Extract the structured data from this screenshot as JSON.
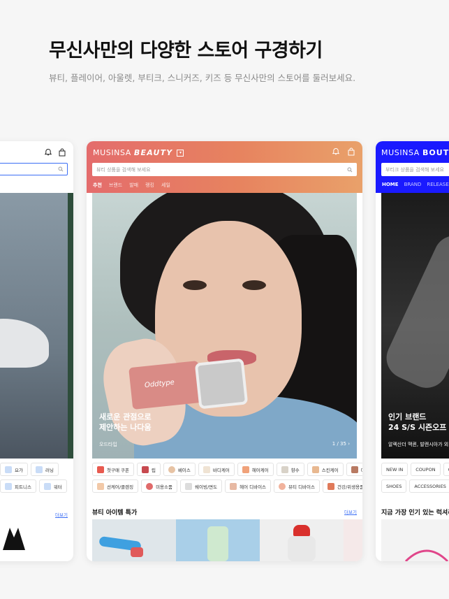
{
  "headline": "무신사만의 다양한 스토어 구경하기",
  "subline": "뷰티, 플레이어, 아울렛, 부티크, 스니커즈, 키즈 등 무신사만의 스토어를 둘러보세요.",
  "left_card": {
    "chips_row1": [
      "요가",
      "러닝"
    ],
    "chips_row2": [
      "피트니스",
      "워터"
    ],
    "more": "더보기"
  },
  "beauty_card": {
    "brand_a": "MUSINSA",
    "brand_b": "BEAUTY",
    "search_placeholder": "뷰티 상품을 검색해 보세요",
    "tabs": [
      "추천",
      "브랜드",
      "발매",
      "랭킹",
      "세일"
    ],
    "hero": {
      "product_label": "Oddtype",
      "title": "새로운 관점으로\n제안하는 나다움",
      "subtitle": "오드타입",
      "page": "1 / 35"
    },
    "chips_row1": [
      "첫구매 쿠폰",
      "립",
      "베이스",
      "바디케어",
      "헤어케어",
      "향수",
      "스킨케어",
      "아이"
    ],
    "chips_row2": [
      "선케어/클렌징",
      "미용소품",
      "쉐이빙/면도",
      "헤어 디바이스",
      "뷰티 디바이스",
      "건강/위생용품"
    ],
    "section_title": "뷰티 아이템 특가",
    "section_more": "더보기"
  },
  "boutique_card": {
    "brand_a": "MUSINSA",
    "brand_b": "BOUTIQUE",
    "search_placeholder": "부티크 상품을 검색해 보세요",
    "tabs": [
      "HOME",
      "BRAND",
      "RELEASES"
    ],
    "hero": {
      "title": "인기 브랜드\n24 S/S 시즌오프",
      "subtitle": "알렉산더 맥퀸, 발렌시아가 외"
    },
    "chips_row1": [
      "NEW IN",
      "COUPON",
      "OU"
    ],
    "chips_row2": [
      "SHOES",
      "ACCESSORIES"
    ],
    "section_title": "지금 가장 인기 있는 럭셔리"
  },
  "colors": {
    "beauty_gradient_start": "#e46c6c",
    "beauty_gradient_end": "#e9a16a",
    "boutique_blue": "#1a1aff",
    "link_blue": "#3b6ef5"
  }
}
